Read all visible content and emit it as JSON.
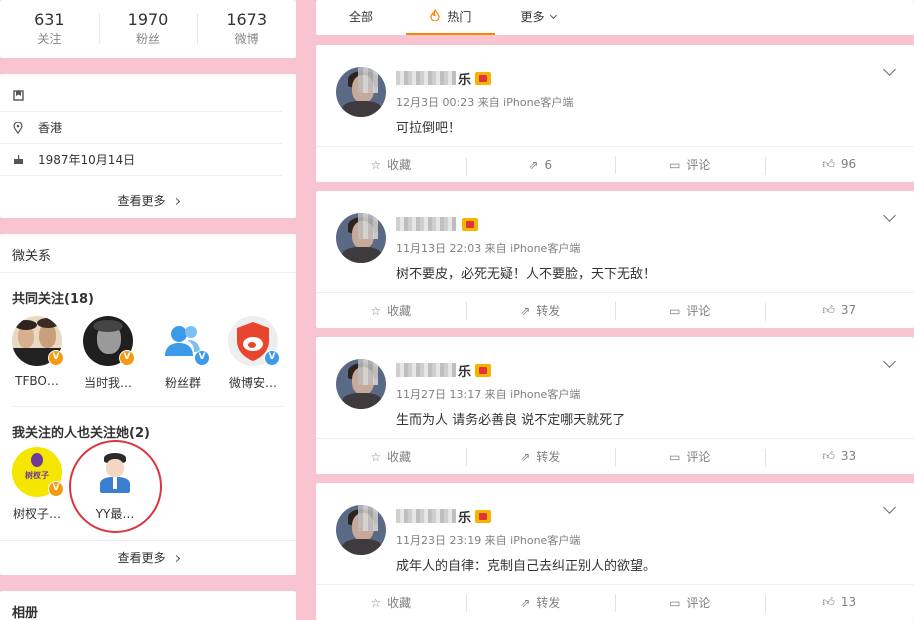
{
  "stats": [
    {
      "num": "631",
      "label": "关注"
    },
    {
      "num": "1970",
      "label": "粉丝"
    },
    {
      "num": "1673",
      "label": "微博"
    }
  ],
  "info": {
    "location": "香港",
    "birthday": "1987年10月14日",
    "more": "查看更多"
  },
  "relations": {
    "title": "微关系",
    "common_title": "共同关注(18)",
    "common": [
      {
        "name": "TFBO…",
        "badge": "V",
        "badge_color": "gold"
      },
      {
        "name": "当时我…",
        "badge": "V",
        "badge_color": "gold"
      },
      {
        "name": "粉丝群",
        "badge": "V",
        "badge_color": "blue"
      },
      {
        "name": "微博安…",
        "badge": "V",
        "badge_color": "blue"
      }
    ],
    "also_title": "我关注的人也关注她(2)",
    "also": [
      {
        "name": "树杈子…",
        "badge": "V",
        "badge_color": "gold",
        "logo_text": "树杈子"
      },
      {
        "name": "YY最…"
      }
    ],
    "more": "查看更多"
  },
  "album": {
    "title": "相册"
  },
  "tabs": {
    "all": "全部",
    "hot": "热门",
    "more": "更多"
  },
  "posts": [
    {
      "name_tail": "乐",
      "meta": "12月3日 00:23 来自 iPhone客户端",
      "text": "可拉倒吧！",
      "collect": "收藏",
      "repost": "6",
      "comment": "评论",
      "likes": "96"
    },
    {
      "name_tail": "",
      "meta": "11月13日 22:03 来自 iPhone客户端",
      "text": "树不要皮，必死无疑！人不要脸，天下无敌！",
      "collect": "收藏",
      "repost": "转发",
      "comment": "评论",
      "likes": "37"
    },
    {
      "name_tail": "乐",
      "meta": "11月27日 13:17 来自 iPhone客户端",
      "text": "生而为人 请务必善良 说不定哪天就死了",
      "collect": "收藏",
      "repost": "转发",
      "comment": "评论",
      "likes": "33"
    },
    {
      "name_tail": "乐",
      "meta": "11月23日 23:19 来自 iPhone客户端",
      "text": "成年人的自律：克制自己去纠正别人的欲望。",
      "collect": "收藏",
      "repost": "转发",
      "comment": "评论",
      "likes": "13"
    }
  ],
  "colors": {
    "accent": "#ff8200",
    "background": "#f7c4cf",
    "gold_badge": "#f39c12",
    "blue_badge": "#3d9ae8",
    "highlight": "#d9363e"
  }
}
